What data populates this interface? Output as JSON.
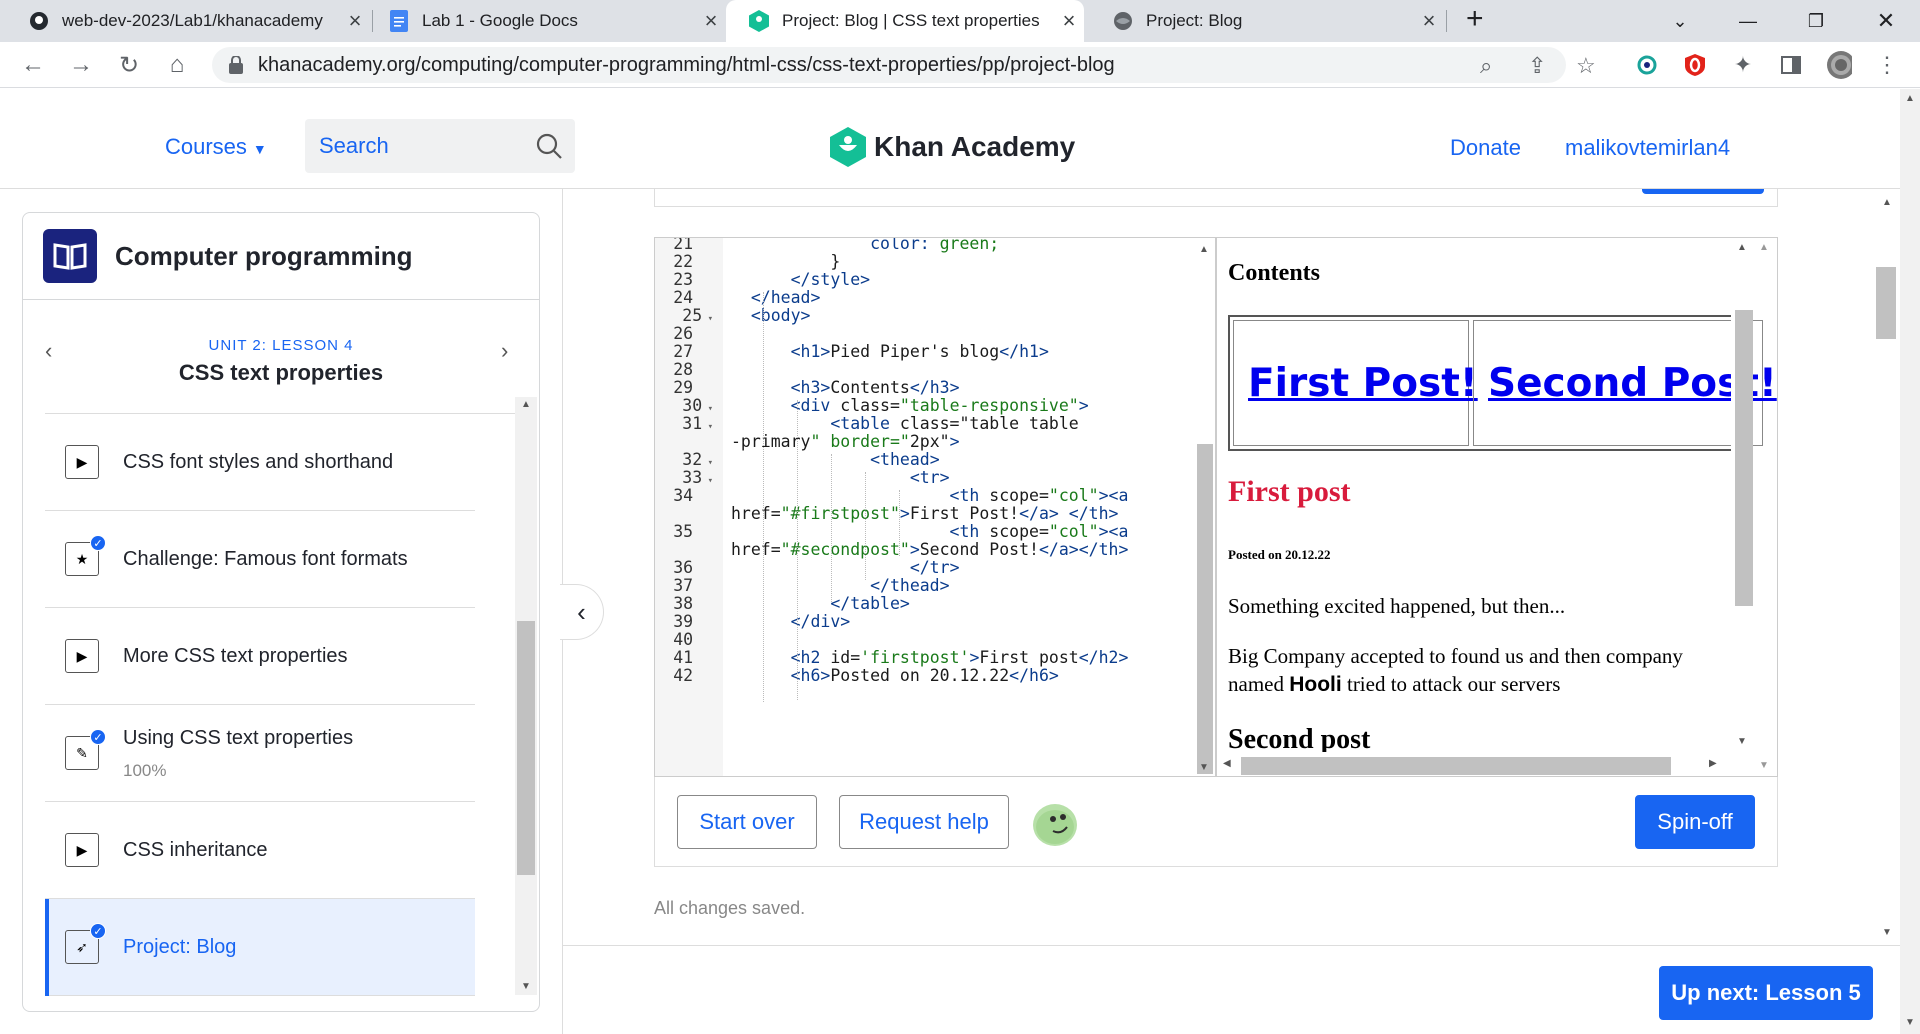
{
  "browser": {
    "tabs": [
      {
        "title": "web-dev-2023/Lab1/khanacademy",
        "icon": "github-icon"
      },
      {
        "title": "Lab 1 - Google Docs",
        "icon": "docs-icon"
      },
      {
        "title": "Project: Blog | CSS text properties",
        "icon": "khan-icon"
      },
      {
        "title": "Project: Blog",
        "icon": "globe-icon"
      }
    ],
    "url": "khanacademy.org/computing/computer-programming/html-css/css-text-properties/pp/project-blog"
  },
  "header": {
    "courses": "Courses",
    "search_placeholder": "Search",
    "logo": "Khan Academy",
    "donate": "Donate",
    "username": "malikovtemirlan4"
  },
  "sidebar": {
    "course_title": "Computer programming",
    "unit": "UNIT 2: LESSON 4",
    "lesson_title": "CSS text properties",
    "items": [
      {
        "label": "CSS font styles and shorthand",
        "icon": "play-icon",
        "sub": ""
      },
      {
        "label": "Challenge: Famous font formats",
        "icon": "star-icon",
        "sub": ""
      },
      {
        "label": "More CSS text properties",
        "icon": "play-icon",
        "sub": ""
      },
      {
        "label": "Using CSS text properties",
        "icon": "pencil-icon",
        "sub": "100%"
      },
      {
        "label": "CSS inheritance",
        "icon": "play-icon",
        "sub": ""
      },
      {
        "label": "Project: Blog",
        "icon": "rocket-icon",
        "sub": ""
      }
    ]
  },
  "editor": {
    "lines": [
      {
        "n": "21",
        "fold": false,
        "code": "              color: green;"
      },
      {
        "n": "22",
        "fold": false,
        "code": "          }"
      },
      {
        "n": "23",
        "fold": false,
        "code": "      </style>"
      },
      {
        "n": "24",
        "fold": false,
        "code": "  </head>"
      },
      {
        "n": "25",
        "fold": true,
        "code": "  <body>"
      },
      {
        "n": "26",
        "fold": false,
        "code": ""
      },
      {
        "n": "27",
        "fold": false,
        "code": "      <h1>Pied Piper's blog</h1>"
      },
      {
        "n": "28",
        "fold": false,
        "code": ""
      },
      {
        "n": "29",
        "fold": false,
        "code": "      <h3>Contents</h3>"
      },
      {
        "n": "30",
        "fold": true,
        "code": "      <div class=\"table-responsive\">"
      },
      {
        "n": "31",
        "fold": true,
        "code": "          <table class=\"table table"
      },
      {
        "n": "",
        "fold": false,
        "code": "-primary\" border=\"2px\">"
      },
      {
        "n": "32",
        "fold": true,
        "code": "              <thead>"
      },
      {
        "n": "33",
        "fold": true,
        "code": "                  <tr>"
      },
      {
        "n": "34",
        "fold": false,
        "code": "                      <th scope=\"col\"><a"
      },
      {
        "n": "",
        "fold": false,
        "code": "href=\"#firstpost\">First Post!</a> </th>"
      },
      {
        "n": "35",
        "fold": false,
        "code": "                      <th scope=\"col\"><a"
      },
      {
        "n": "",
        "fold": false,
        "code": "href=\"#secondpost\">Second Post!</a></th>"
      },
      {
        "n": "36",
        "fold": false,
        "code": "                  </tr>"
      },
      {
        "n": "37",
        "fold": false,
        "code": "              </thead>"
      },
      {
        "n": "38",
        "fold": false,
        "code": "          </table>"
      },
      {
        "n": "39",
        "fold": false,
        "code": "      </div>"
      },
      {
        "n": "40",
        "fold": false,
        "code": ""
      },
      {
        "n": "41",
        "fold": false,
        "code": "      <h2 id='firstpost'>First post</h2>"
      },
      {
        "n": "42",
        "fold": false,
        "code": "      <h6>Posted on 20.12.22</h6>"
      }
    ]
  },
  "preview": {
    "contents": "Contents",
    "link1": "First Post!",
    "link2": "Second Post!",
    "post_title": "First post",
    "posted": "Posted on 20.12.22",
    "p1": "Something excited happened, but then...",
    "p2_before": "Big Company accepted to found us and then company named ",
    "p2_bold": "Hooli",
    "p2_after": " tried to attack our servers",
    "next_heading": "Second post"
  },
  "toolbar": {
    "start_over": "Start over",
    "request_help": "Request help",
    "spin_off": "Spin-off"
  },
  "status": "All changes saved.",
  "up_next": "Up next: Lesson 5"
}
